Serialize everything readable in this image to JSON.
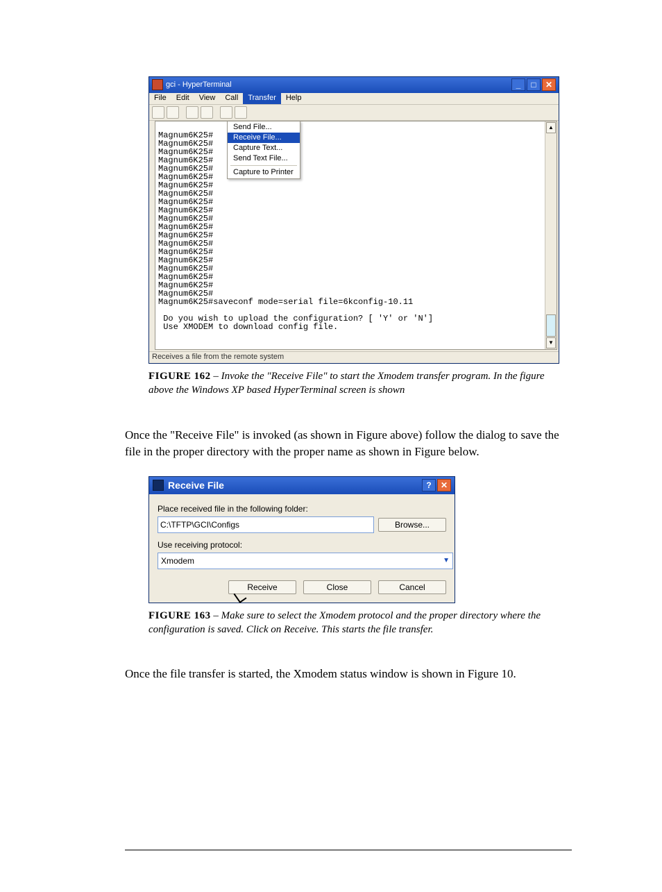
{
  "hyperterminal": {
    "title": "gci - HyperTerminal",
    "menus": [
      "File",
      "Edit",
      "View",
      "Call",
      "Transfer",
      "Help"
    ],
    "open_menu_index": 4,
    "dropdown": [
      {
        "label": "Send File...",
        "on": false
      },
      {
        "label": "Receive File...",
        "on": true
      },
      {
        "label": "Capture Text...",
        "on": false
      },
      {
        "label": "Send Text File...",
        "on": false
      },
      {
        "sep": true
      },
      {
        "label": "Capture to Printer",
        "on": false
      }
    ],
    "terminal_lines": [
      "Magnum6K25#",
      "Magnum6K25#",
      "Magnum6K25#",
      "Magnum6K25#",
      "Magnum6K25#",
      "Magnum6K25#",
      "Magnum6K25#",
      "Magnum6K25#",
      "Magnum6K25#",
      "Magnum6K25#",
      "Magnum6K25#",
      "Magnum6K25#",
      "Magnum6K25#",
      "Magnum6K25#",
      "Magnum6K25#",
      "Magnum6K25#",
      "Magnum6K25#",
      "Magnum6K25#",
      "Magnum6K25#",
      "Magnum6K25#",
      "Magnum6K25#saveconf mode=serial file=6kconfig-10.11",
      "",
      " Do you wish to upload the configuration? [ 'Y' or 'N']",
      " Use XMODEM to download config file.",
      ""
    ],
    "status": "Receives a file from the remote system"
  },
  "fig162": {
    "lead": "FIGURE 162",
    "rest": " – Invoke the \"Receive File\" to start the Xmodem transfer program. In the figure above the Windows XP based HyperTerminal screen is shown"
  },
  "para1": "Once the \"Receive File\" is invoked (as shown in Figure above) follow the dialog to save the file in the proper directory with the proper name as shown in Figure below.",
  "receive_dialog": {
    "title": "Receive File",
    "folder_label": "Place received file in the following folder:",
    "folder_value": "C:\\TFTP\\GCI\\Configs",
    "browse": "Browse...",
    "protocol_label": "Use receiving protocol:",
    "protocol_value": "Xmodem",
    "btn_receive": "Receive",
    "btn_close": "Close",
    "btn_cancel": "Cancel"
  },
  "fig163": {
    "lead": "FIGURE 163",
    "rest": " – Make sure to select the Xmodem protocol and the proper directory where the configuration is saved. Click on Receive. This starts the file transfer."
  },
  "para2": "Once the file transfer is started, the Xmodem status window is shown in Figure 10."
}
